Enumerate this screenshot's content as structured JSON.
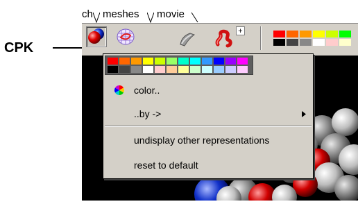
{
  "callout": {
    "label": "CPK"
  },
  "tabs": [
    {
      "label": "ch"
    },
    {
      "label": "meshes"
    },
    {
      "label": "movie"
    }
  ],
  "toolbar": {
    "buttons": [
      {
        "icon": "cpk-spheres-icon",
        "pressed": true
      },
      {
        "icon": "mesh-surface-icon",
        "pressed": false
      },
      {
        "icon": "cartoon-icon",
        "pressed": false
      },
      {
        "icon": "ribbon-icon",
        "pressed": false
      }
    ],
    "plus_label": "+",
    "palette_row1": [
      "#ff0000",
      "#ff6600",
      "#ff9900",
      "#ffff00",
      "#ccff00",
      "#00ff00"
    ],
    "palette_row2": [
      "#000000",
      "#444444",
      "#888888",
      "#ffffff",
      "#ffcccc",
      "#ffffcc"
    ]
  },
  "menu": {
    "palette_row1": [
      "#ff0000",
      "#ff6600",
      "#ff9900",
      "#ffff00",
      "#ccff00",
      "#99ff66",
      "#00ffcc",
      "#00ffff",
      "#3399ff",
      "#0000ff",
      "#9900ff",
      "#ff00ff"
    ],
    "palette_row2": [
      "#000000",
      "#444444",
      "#888888",
      "#ffffff",
      "#ffcccc",
      "#ffcc99",
      "#ffff99",
      "#ccffcc",
      "#ccffff",
      "#99ccff",
      "#ccccff",
      "#ffccff"
    ],
    "items": {
      "color": "color..",
      "by": "..by ->",
      "undisplay": "undisplay other representations",
      "reset": "reset to default"
    }
  }
}
